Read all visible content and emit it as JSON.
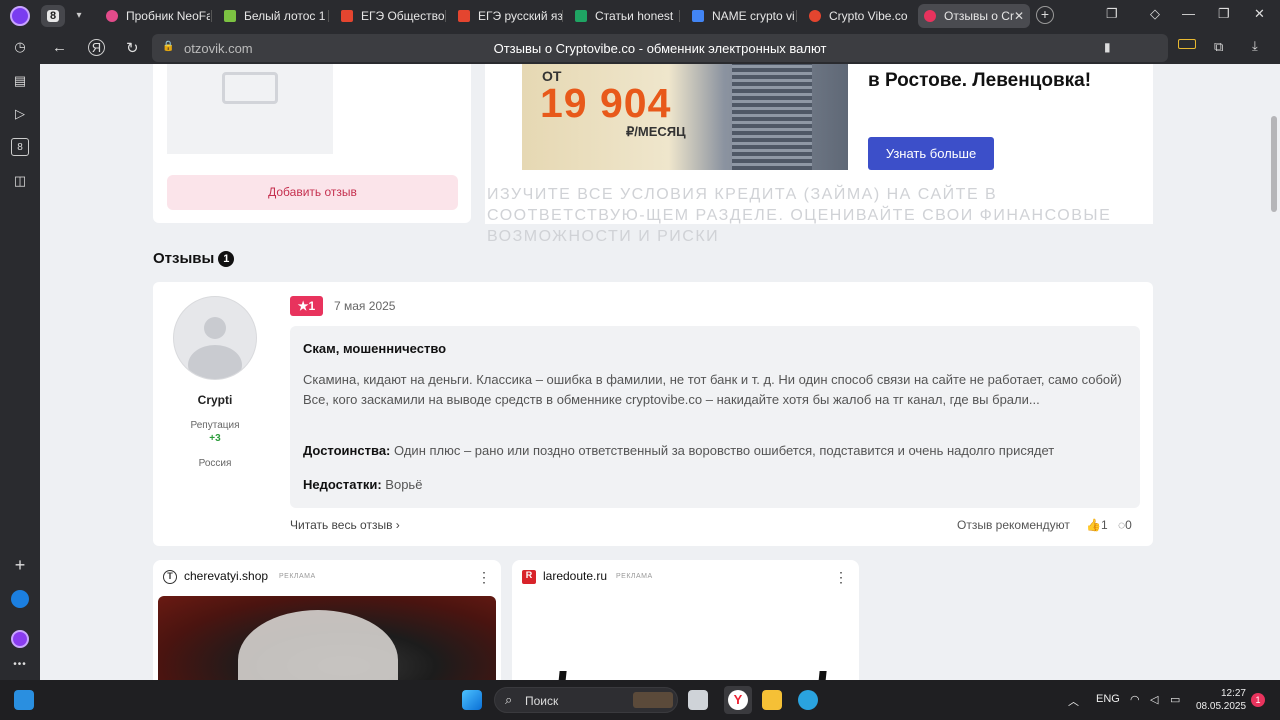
{
  "browser": {
    "tab_count": "8",
    "tabs": [
      {
        "title": "Пробник NeoFa",
        "color": "#e24b8a"
      },
      {
        "title": "Белый лотос 1",
        "color": "#7cc242"
      },
      {
        "title": "ЕГЭ Общество",
        "color": "#e4452f"
      },
      {
        "title": "ЕГЭ русский яз",
        "color": "#e4452f"
      },
      {
        "title": "Статьи honest",
        "color": "#1fa463"
      },
      {
        "title": "NAME crypto vi",
        "color": "#4285f4"
      },
      {
        "title": "Crypto Vibe.co",
        "color": "#e4452f"
      },
      {
        "title": "Отзывы о Cr",
        "color": "#e8335d"
      }
    ],
    "domain": "otzovik.com",
    "page_title": "Отзывы о Cryptovibe.co - обменник электронных валют"
  },
  "top_section": {
    "add_review_label": "Добавить отзыв",
    "ad": {
      "price_prefix": "ОТ",
      "price": "19 904",
      "price_suffix": "₽/МЕСЯЦ",
      "headline": "в Ростове. Левенцовка!",
      "button_label": "Узнать больше",
      "disclaimer": "ИЗУЧИТЕ ВСЕ УСЛОВИЯ КРЕДИТА (ЗАЙМА) НА САЙТЕ В СООТВЕТСТВУЮ-ЩЕМ РАЗДЕЛЕ. ОЦЕНИВАЙТЕ СВОИ ФИНАНСОВЫЕ ВОЗМОЖНОСТИ И РИСКИ"
    }
  },
  "reviews": {
    "section_title": "Отзывы",
    "count": "1",
    "items": [
      {
        "user": {
          "name": "Crypti",
          "reputation_label": "Репутация",
          "reputation_value": "+3",
          "country": "Россия"
        },
        "rating": "1",
        "date": "7 мая 2025",
        "title": "Скам, мошенничество",
        "text": "Скамина, кидают на деньги. Классика – ошибка в фамилии, не тот банк и т. д. Ни один способ связи на сайте не работает, само собой) Все, кого заскамили на выводе средств в обменнике cryptovibe.co – накидайте хотя бы жалоб на тг канал, где вы брали...",
        "pros_label": "Достоинства:",
        "pros": "Один плюс – рано или поздно ответственный за воровство ошибется, подставится и очень надолго присядет",
        "cons_label": "Недостатки:",
        "cons": "Ворьё",
        "read_all_label": "Читать весь отзыв ›",
        "recommend_label": "Отзыв рекомендуют",
        "likes": "1",
        "comments": "0"
      }
    ]
  },
  "ad_cards": [
    {
      "domain": "cherevatyi.shop",
      "tag": "РЕКЛАМА"
    },
    {
      "domain": "laredoute.ru",
      "tag": "РЕКЛАМА"
    }
  ],
  "taskbar": {
    "search_label": "Поиск",
    "language": "ENG",
    "time": "12:27",
    "date": "08.05.2025",
    "notifications": "1"
  }
}
